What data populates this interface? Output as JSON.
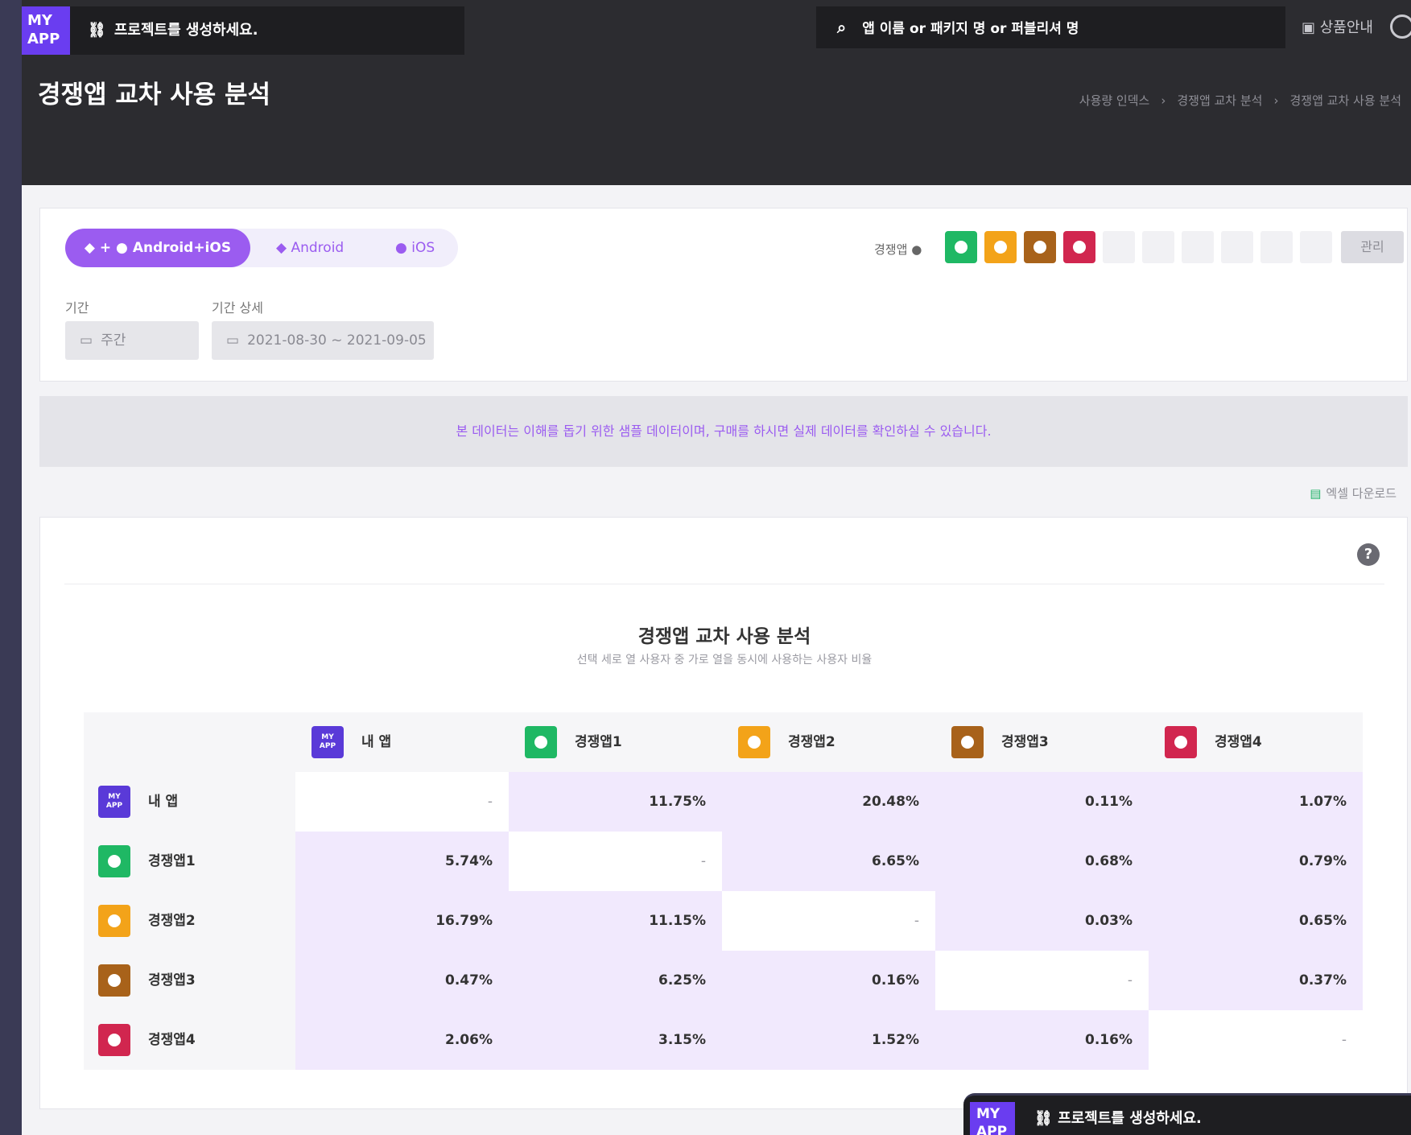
{
  "app": {
    "logo_line1": "MY",
    "logo_line2": "APP",
    "project_prompt": "프로젝트를 생성하세요."
  },
  "search": {
    "placeholder": "앱 이름 or 패키지 명 or 퍼블리셔 명"
  },
  "header": {
    "product_info": "상품안내",
    "page_title": "경쟁앱 교차 사용 분석"
  },
  "breadcrumb": [
    "사용량 인덱스",
    "경쟁앱 교차 분석",
    "경쟁앱 교차 사용 분석"
  ],
  "platform": {
    "active": "Android+iOS",
    "android": "Android",
    "ios": "iOS"
  },
  "period": {
    "label": "기간",
    "value": "주간",
    "detail_label": "기간 상세",
    "detail_value": "2021-08-30 ~ 2021-09-05"
  },
  "competitors": {
    "label": "경쟁앱",
    "manage": "관리",
    "badge_colors": [
      "#1fb864",
      "#f3a319",
      "#a8621a",
      "#d1264f"
    ]
  },
  "notice": "본 데이터는 이해를 돕기 위한 샘플 데이터이며, 구매를 하시면 실제 데이터를 확인하실 수 있습니다.",
  "excel_download": "엑셀 다운로드",
  "chart": {
    "title": "경쟁앱 교차 사용 분석",
    "subtitle": "선택 세로 열 사용자 중 가로 열을 동시에 사용하는 사용자 비율"
  },
  "table": {
    "columns": [
      "내 앱",
      "경쟁앱1",
      "경쟁앱2",
      "경쟁앱3",
      "경쟁앱4"
    ],
    "rows": [
      {
        "name": "내 앱",
        "values": [
          "-",
          "11.75%",
          "20.48%",
          "0.11%",
          "1.07%"
        ]
      },
      {
        "name": "경쟁앱1",
        "values": [
          "5.74%",
          "-",
          "6.65%",
          "0.68%",
          "0.79%"
        ]
      },
      {
        "name": "경쟁앱2",
        "values": [
          "16.79%",
          "11.15%",
          "-",
          "0.03%",
          "0.65%"
        ]
      },
      {
        "name": "경쟁앱3",
        "values": [
          "0.47%",
          "6.25%",
          "0.16%",
          "-",
          "0.37%"
        ]
      },
      {
        "name": "경쟁앱4",
        "values": [
          "2.06%",
          "3.15%",
          "1.52%",
          "0.16%",
          "-"
        ]
      }
    ]
  },
  "floating": {
    "logo_line1": "MY",
    "logo_line2": "APP",
    "text": "프로젝트를 생성하세요."
  }
}
